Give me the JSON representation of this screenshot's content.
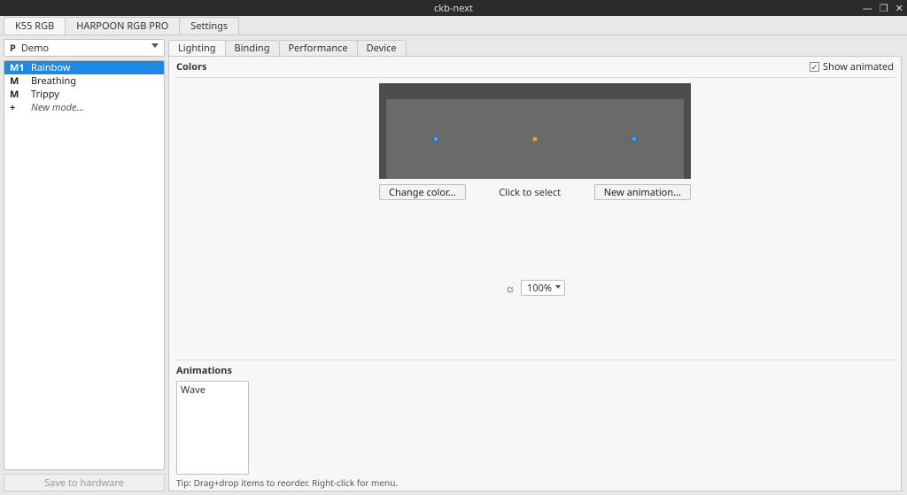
{
  "window": {
    "title": "ckb-next",
    "controls": {
      "minimize": "—",
      "maximize": "❐",
      "close": "✕"
    }
  },
  "top_tabs": [
    {
      "label": "K55 RGB",
      "active": true
    },
    {
      "label": "HARPOON RGB PRO",
      "active": false
    },
    {
      "label": "Settings",
      "active": false
    }
  ],
  "sidebar": {
    "profile": {
      "prefix": "P",
      "name": "Demo"
    },
    "modes": [
      {
        "badge": "M1",
        "label": "Rainbow",
        "selected": true
      },
      {
        "badge": "M",
        "label": "Breathing",
        "selected": false
      },
      {
        "badge": "M",
        "label": "Trippy",
        "selected": false
      }
    ],
    "new_mode": {
      "badge": "+",
      "label": "New mode..."
    },
    "save_btn": "Save to hardware"
  },
  "sub_tabs": [
    {
      "label": "Lighting",
      "active": true
    },
    {
      "label": "Binding",
      "active": false
    },
    {
      "label": "Performance",
      "active": false
    },
    {
      "label": "Device",
      "active": false
    }
  ],
  "colors": {
    "section_label": "Colors",
    "show_animated": {
      "label": "Show animated",
      "checked": true
    },
    "zones": [
      {
        "name": "zone-left",
        "color": "#4aa3ff"
      },
      {
        "name": "zone-mid",
        "color": "#e0a24a"
      },
      {
        "name": "zone-right",
        "color": "#4aa3ff"
      }
    ],
    "change_color_btn": "Change color...",
    "click_hint": "Click to select",
    "new_anim_btn": "New animation...",
    "brightness": {
      "value": "100%"
    }
  },
  "animations": {
    "section_label": "Animations",
    "items": [
      {
        "label": "Wave"
      }
    ],
    "tip": "Tip: Drag+drop items to reorder. Right-click for menu."
  }
}
